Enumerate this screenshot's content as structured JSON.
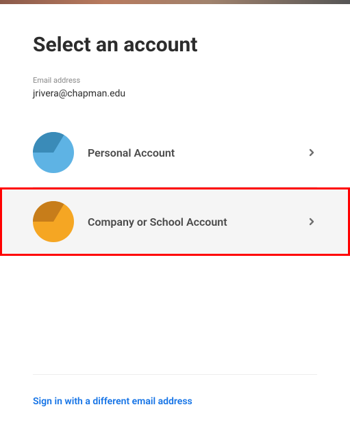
{
  "title": "Select an account",
  "email": {
    "label": "Email address",
    "value": "jrivera@chapman.edu"
  },
  "accounts": [
    {
      "label": "Personal Account",
      "highlighted": false
    },
    {
      "label": "Company or School Account",
      "highlighted": true
    }
  ],
  "altLink": "Sign in with a different email address"
}
